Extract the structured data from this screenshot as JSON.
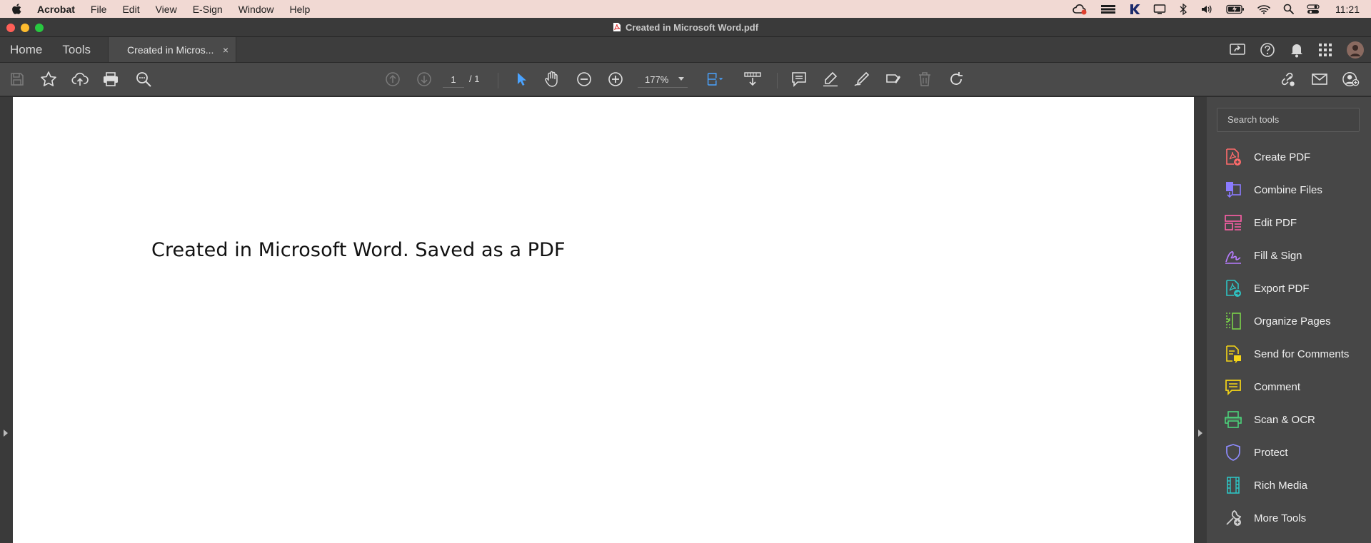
{
  "menubar": {
    "app_name": "Acrobat",
    "items": [
      "File",
      "Edit",
      "View",
      "E-Sign",
      "Window",
      "Help"
    ],
    "clock": "11:21"
  },
  "window": {
    "title": "Created in Microsoft Word.pdf"
  },
  "tabbar": {
    "home": "Home",
    "tools": "Tools",
    "doc_tab": "Created in Micros...",
    "close": "×"
  },
  "toolbar": {
    "page_current": "1",
    "page_total": "/ 1",
    "zoom": "177%"
  },
  "document": {
    "text": "Created in Microsoft Word. Saved as a PDF"
  },
  "tools_pane": {
    "search_placeholder": "Search tools",
    "items": [
      {
        "label": "Create PDF",
        "icon": "create-pdf-icon",
        "color": "#ff6b6b"
      },
      {
        "label": "Combine Files",
        "icon": "combine-files-icon",
        "color": "#8b7bff"
      },
      {
        "label": "Edit PDF",
        "icon": "edit-pdf-icon",
        "color": "#ff5fa8"
      },
      {
        "label": "Fill & Sign",
        "icon": "fill-sign-icon",
        "color": "#b77cff"
      },
      {
        "label": "Export PDF",
        "icon": "export-pdf-icon",
        "color": "#2ec4c4"
      },
      {
        "label": "Organize Pages",
        "icon": "organize-pages-icon",
        "color": "#7ad34a"
      },
      {
        "label": "Send for Comments",
        "icon": "send-for-comments-icon",
        "color": "#f5d516"
      },
      {
        "label": "Comment",
        "icon": "comment-icon",
        "color": "#f5d516"
      },
      {
        "label": "Scan & OCR",
        "icon": "scan-ocr-icon",
        "color": "#4cd37a"
      },
      {
        "label": "Protect",
        "icon": "protect-icon",
        "color": "#8f8cff"
      },
      {
        "label": "Rich Media",
        "icon": "rich-media-icon",
        "color": "#2ec4c4"
      },
      {
        "label": "More Tools",
        "icon": "more-tools-icon",
        "color": "#d0d0d0"
      }
    ]
  }
}
